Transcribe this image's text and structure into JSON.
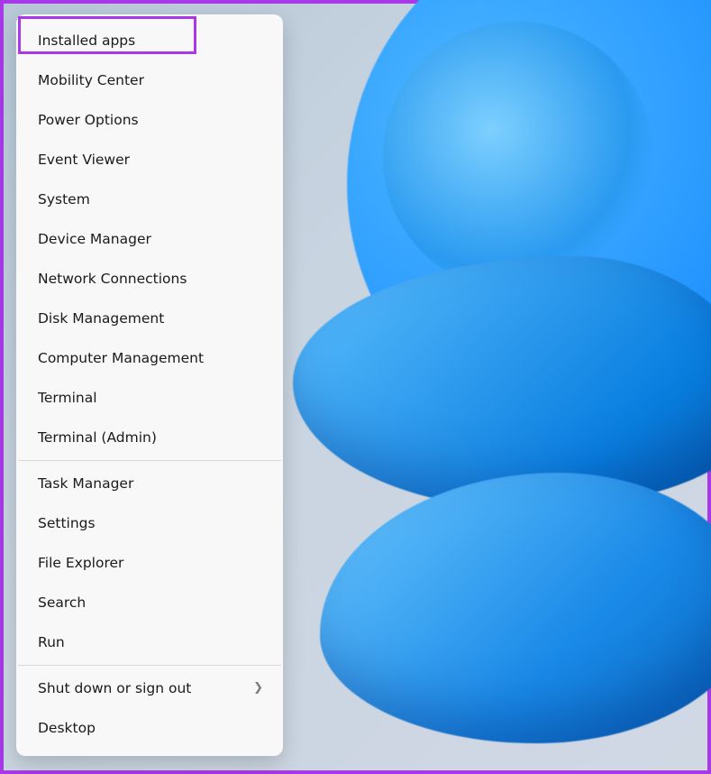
{
  "menu": {
    "group1": [
      {
        "label": "Installed apps"
      },
      {
        "label": "Mobility Center"
      },
      {
        "label": "Power Options"
      },
      {
        "label": "Event Viewer"
      },
      {
        "label": "System"
      },
      {
        "label": "Device Manager"
      },
      {
        "label": "Network Connections"
      },
      {
        "label": "Disk Management"
      },
      {
        "label": "Computer Management"
      },
      {
        "label": "Terminal"
      },
      {
        "label": "Terminal (Admin)"
      }
    ],
    "group2": [
      {
        "label": "Task Manager"
      },
      {
        "label": "Settings"
      },
      {
        "label": "File Explorer"
      },
      {
        "label": "Search"
      },
      {
        "label": "Run"
      }
    ],
    "group3": [
      {
        "label": "Shut down or sign out",
        "submenu": true
      },
      {
        "label": "Desktop"
      }
    ]
  },
  "highlight_color": "#a838e8"
}
